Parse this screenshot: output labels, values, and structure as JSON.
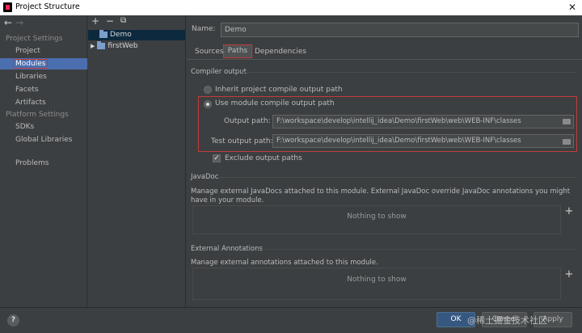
{
  "window": {
    "title": "Project Structure",
    "close_glyph": "✕"
  },
  "nav": {
    "back": "←",
    "forward": "→"
  },
  "sidebar": {
    "project_settings_label": "Project Settings",
    "project_items": [
      {
        "label": "Project"
      },
      {
        "label": "Modules"
      },
      {
        "label": "Libraries"
      },
      {
        "label": "Facets"
      },
      {
        "label": "Artifacts"
      }
    ],
    "platform_settings_label": "Platform Settings",
    "platform_items": [
      {
        "label": "SDKs"
      },
      {
        "label": "Global Libraries"
      }
    ],
    "problems_label": "Problems"
  },
  "tree": {
    "toolbar": {
      "add": "+",
      "remove": "−",
      "copy": "⧉"
    },
    "rows": [
      {
        "label": "Demo",
        "expander": ""
      },
      {
        "label": "firstWeb",
        "expander": "▶"
      }
    ]
  },
  "main": {
    "name_label": "Name:",
    "name_value": "Demo",
    "tabs": [
      {
        "label": "Sources"
      },
      {
        "label": "Paths"
      },
      {
        "label": "Dependencies"
      }
    ],
    "compiler_output_title": "Compiler output",
    "inherit_label": "Inherit project compile output path",
    "use_module_label": "Use module compile output path",
    "output_path_label": "Output path:",
    "output_path_value": "F:\\workspace\\develop\\intellij_idea\\Demo\\firstWeb\\web\\WEB-INF\\classes",
    "test_output_path_label": "Test output path:",
    "test_output_path_value": "F:\\workspace\\develop\\intellij_idea\\Demo\\firstWeb\\web\\WEB-INF\\classes",
    "exclude_label": "Exclude output paths",
    "exclude_check": "✓",
    "javadoc_title": "JavaDoc",
    "javadoc_desc": "Manage external JavaDocs attached to this module. External JavaDoc override JavaDoc annotations you might have in your module.",
    "javadoc_empty": "Nothing to show",
    "annotations_title": "External Annotations",
    "annotations_desc": "Manage external annotations attached to this module.",
    "annotations_empty": "Nothing to show",
    "add_glyph": "+"
  },
  "footer": {
    "help": "?",
    "ok": "OK",
    "cancel": "Cancel",
    "apply": "Apply",
    "watermark": "@稀土掘金技术社区"
  },
  "colors": {
    "background": "#3c3f41",
    "selection": "#4b6eaf",
    "highlight_red": "#c23b3b",
    "primary_button": "#365880"
  }
}
